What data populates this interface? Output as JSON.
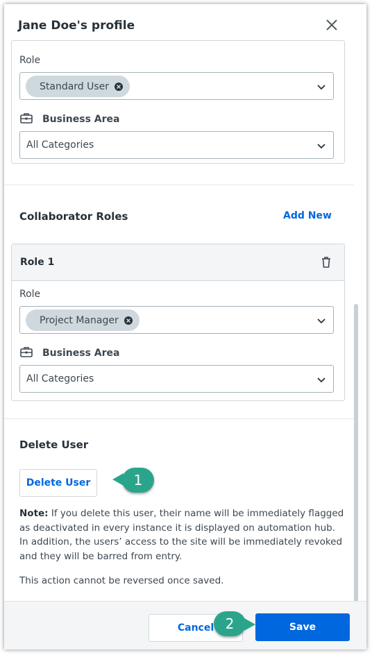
{
  "panel": {
    "title": "Jane Doe's profile"
  },
  "primary_role": {
    "role_label": "Role",
    "role_chip": "Standard User",
    "business_area_label": "Business Area",
    "business_area_value": "All Categories"
  },
  "collaborator_roles": {
    "title": "Collaborator Roles",
    "add_new_label": "Add New",
    "roles": [
      {
        "header": "Role 1",
        "role_label": "Role",
        "role_chip": "Project Manager",
        "business_area_label": "Business Area",
        "business_area_value": "All Categories"
      }
    ]
  },
  "delete_user": {
    "title": "Delete User",
    "button_label": "Delete User",
    "note_prefix": "Note:",
    "note_text": " If you delete this user, their name will be immediately flagged as deactivated in every instance it is displayed on automation hub. In addition, the users’ access to the site will be immediately revoked and they will be barred from entry.",
    "irreversible_text": "This action cannot be reversed once saved."
  },
  "footer": {
    "cancel_label": "Cancel",
    "save_label": "Save"
  },
  "callouts": {
    "first": "1",
    "second": "2"
  },
  "colors": {
    "accent": "#0067df",
    "callout": "#2aa58c",
    "chip": "#cfd8dd"
  }
}
